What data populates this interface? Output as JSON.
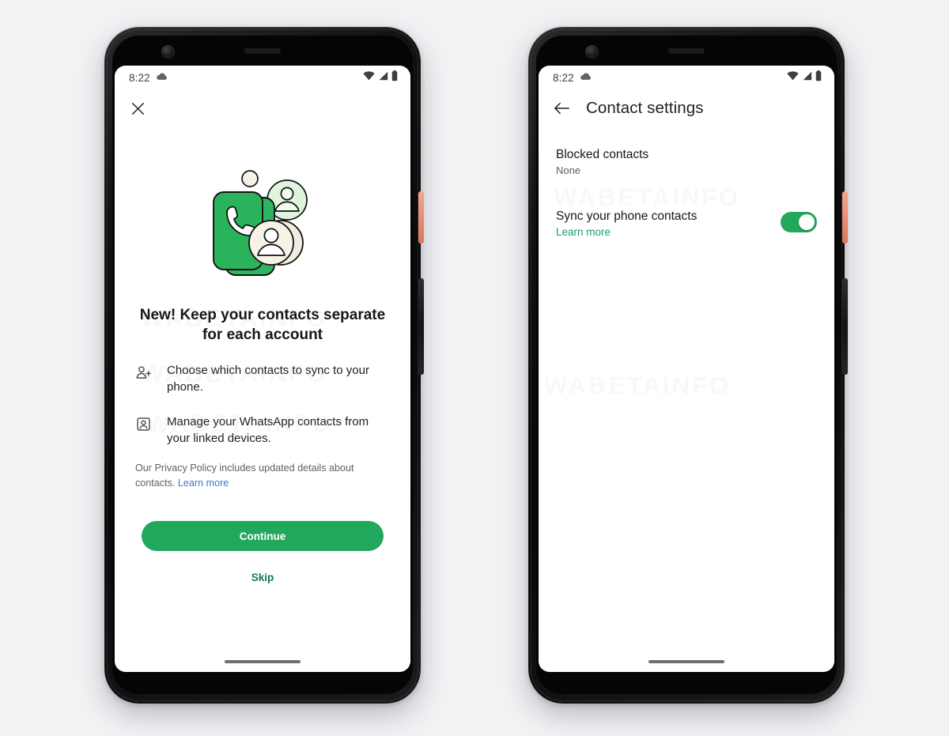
{
  "background_color": "#f1f2f4",
  "accent_green": "#21a85c",
  "link_blue": "#3b77cf",
  "link_green": "#169c6e",
  "watermark": {
    "lines": [
      "WABETAINFO",
      "WABETAINFO",
      "WABETAINFO",
      "WABETAINFO",
      "WABETAINFO"
    ]
  },
  "phone_left": {
    "device_name": "android-phone-mockup",
    "status_bar": {
      "time": "8:22",
      "icons": [
        "cloud-icon",
        "wifi-icon",
        "cellular-signal-icon",
        "battery-icon"
      ]
    },
    "app_bar": {
      "close_icon": "close-icon"
    },
    "illustration": {
      "name": "contacts-sync-illustration",
      "icons": [
        "phone-handset-icon",
        "avatar-icon",
        "avatar-icon",
        "dot-icon"
      ]
    },
    "headline": "New! Keep your contacts separate for each account",
    "features": [
      {
        "icon": "person-add-icon",
        "text": "Choose which contacts to sync to your phone."
      },
      {
        "icon": "contact-card-icon",
        "text": "Manage your WhatsApp contacts from your linked devices."
      }
    ],
    "privacy": {
      "text": "Our Privacy Policy includes updated details about contacts.",
      "link_label": "Learn more"
    },
    "primary_button": "Continue",
    "secondary_button": "Skip"
  },
  "phone_right": {
    "device_name": "android-phone-mockup",
    "status_bar": {
      "time": "8:22",
      "icons": [
        "cloud-icon",
        "wifi-icon",
        "cellular-signal-icon",
        "battery-icon"
      ]
    },
    "app_bar": {
      "back_icon": "back-arrow-icon",
      "title": "Contact settings"
    },
    "rows": [
      {
        "title": "Blocked contacts",
        "subtitle": "None",
        "has_toggle": false
      },
      {
        "title": "Sync your phone contacts",
        "link_label": "Learn more",
        "has_toggle": true,
        "toggle_state": "on"
      }
    ]
  }
}
